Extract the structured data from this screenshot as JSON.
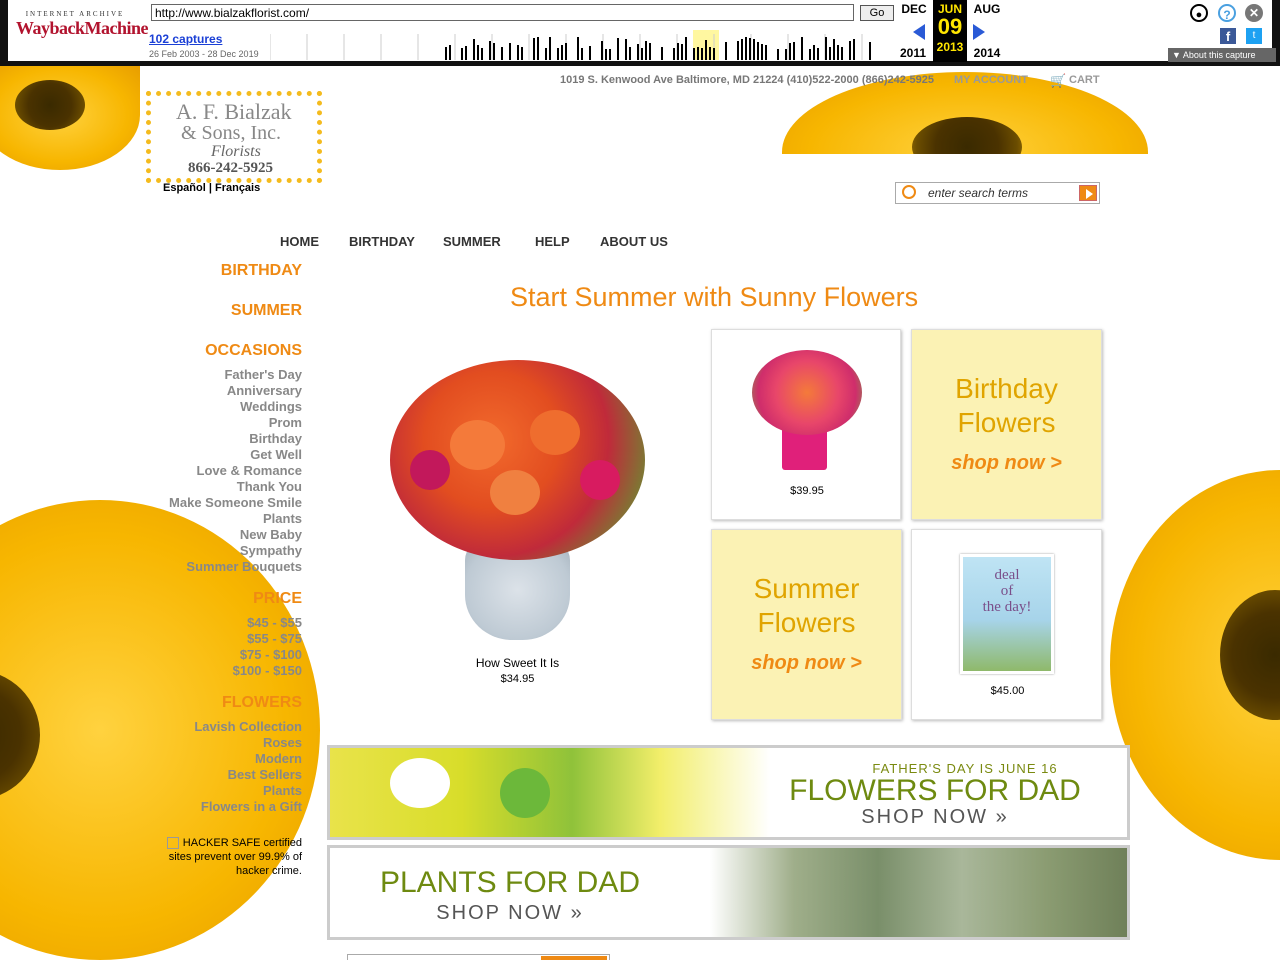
{
  "wayback": {
    "logo_top": "INTERNET ARCHIVE",
    "logo_main": "WaybackMachine",
    "url": "http://www.bialzakflorist.com/",
    "go_label": "Go",
    "captures": "102 captures",
    "range": "26 Feb 2003 - 28 Dec 2019",
    "prev_month": "DEC",
    "cur_month": "JUN",
    "next_month": "AUG",
    "cur_day": "09",
    "prev_year": "2011",
    "cur_year": "2013",
    "next_year": "2014",
    "about": "About this capture"
  },
  "header": {
    "address": "1019 S. Kenwood Ave Baltimore, MD 21224 (410)522-2000 (866)242-5925",
    "my_account": "MY ACCOUNT",
    "cart": "CART",
    "logo_line1": "A. F. Bialzak",
    "logo_line2": "& Sons, Inc.",
    "logo_line3": "Florists",
    "logo_phone": "866-242-5925",
    "languages": "Español | Français",
    "search_placeholder": "enter search terms"
  },
  "nav": [
    "HOME",
    "BIRTHDAY",
    "SUMMER",
    "HELP",
    "ABOUT US"
  ],
  "sidebar": {
    "birthday": "BIRTHDAY",
    "summer": "SUMMER",
    "occasions": "OCCASIONS",
    "occasion_items": [
      "Father's Day",
      "Anniversary",
      "Weddings",
      "Prom",
      "Birthday",
      "Get Well",
      "Love & Romance",
      "Thank You",
      "Make Someone Smile",
      "Plants",
      "New Baby",
      "Sympathy",
      "Summer Bouquets"
    ],
    "price": "PRICE",
    "price_items": [
      "$45 - $55",
      "$55 - $75",
      "$75 - $100",
      "$100 - $150"
    ],
    "flowers": "FLOWERS",
    "flower_items": [
      "Lavish Collection",
      "Roses",
      "Modern",
      "Best Sellers",
      "Plants",
      "Flowers in a Gift"
    ],
    "trust": "HACKER SAFE certified sites prevent over 99.9% of hacker crime."
  },
  "main": {
    "headline": "Start Summer with Sunny Flowers",
    "feature_name": "How Sweet It Is",
    "feature_price": "$34.95",
    "card1_price": "$39.95",
    "promo1_title1": "Birthday",
    "promo1_title2": "Flowers",
    "promo1_cta": "shop now >",
    "promo2_title1": "Summer",
    "promo2_title2": "Flowers",
    "promo2_cta": "shop now >",
    "deal_text1": "deal",
    "deal_text2": "of",
    "deal_text3": "the day!",
    "card2_price": "$45.00",
    "banner1_small": "FATHER'S DAY IS JUNE 16",
    "banner1_big": "FLOWERS FOR DAD",
    "banner1_cta": "SHOP NOW »",
    "banner2_big": "PLANTS FOR DAD",
    "banner2_cta": "SHOP NOW »"
  }
}
